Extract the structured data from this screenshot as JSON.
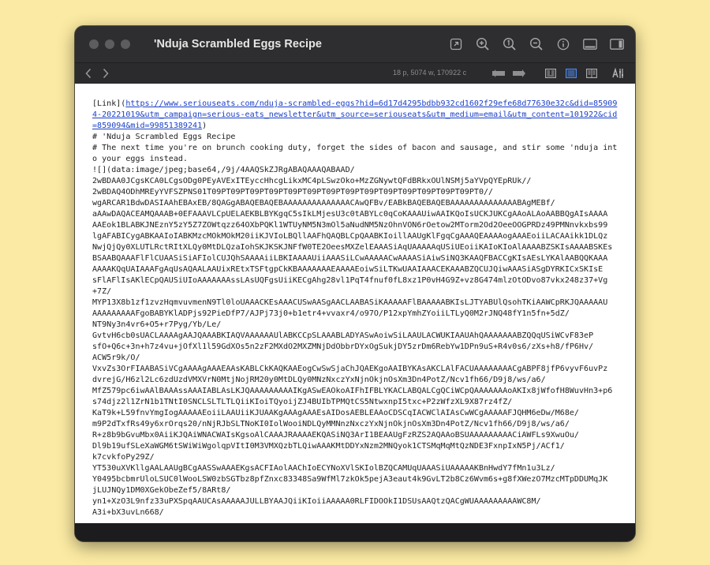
{
  "window": {
    "title": "'Nduja Scrambled Eggs Recipe"
  },
  "titlebar_icons": [
    "share-icon",
    "zoom-in-icon",
    "actual-size-icon",
    "zoom-out-icon",
    "info-icon",
    "sidebar-left-icon",
    "sidebar-right-icon"
  ],
  "toolbar": {
    "stats": "18 p, 5074 w, 170922 c",
    "tools": [
      "fold-icon",
      "unfold-icon",
      "preview-mode-icon",
      "text-mode-icon",
      "split-mode-icon",
      "text-settings-icon"
    ]
  },
  "document": {
    "link_prefix": "[Link](",
    "link_url": "https://www.seriouseats.com/nduja-scrambled-eggs?hid=6d17d4295bdbb932cd1602f29efe68d77630e32c&did=859094-20221019&utm_campaign=serious-eats_newsletter&utm_source=seriouseats&utm_medium=email&utm_content=101922&cid=859094&mid=99851389241",
    "link_suffix": ")",
    "lines": [
      "# 'Nduja Scrambled Eggs Recipe",
      "# The next time you're on brunch cooking duty, forget the sides of bacon and sausage, and stir some 'nduja into your eggs instead.",
      "![](data:image/jpeg;base64,/9j/4AAQSkZJRgABAQAAAQABAAD/",
      "2wBDAA0JCgsKCA0LCgsODg0PEyAVExITEyccHhcgLikxMC4pLSwzOko+MzZGNywtQFdBRkxOUlNSMj5aYVpQYEpRUk//",
      "2wBDAQ4ODhMREyYVFSZPNS01T09PT09PT09PT09PT09PT09PT09PT09PT09PT09PT09PT09PT09PT09PT0//",
      "wgARCAR1BdwDASIAAhEBAxEB/8QAGgABAQEBAQEBAAAAAAAAAAAAAACAwQFBv/EABkBAQEBAQEBAAAAAAAAAAAAAABAgMEBf/",
      "aAAwDAQACEAMQAAAB+0EFAAAVLCpUELAEKBLBYKgqC5sIkLMjesU3c0tABYLc0qCoKAAAUiwAAIKQoIsUCKJUKCgAAoALAoAABBQgAIsAAAA",
      "AAEok1BLABKJNEznY5zY5Z7ZOWtqzz64OXbPQKl1WTUyNM5N3mOl5aNudNM5NzOhnVON6rOetow2MTorm2Od2OeeOOGPRDz49PMNnvkxbs99",
      "lgAFABICygABKAAIoIABKMzcMOkMOkM20iiKJVIoLBQllAAFhQAQBLCpQAABKIoillAAUgKlFgqCgAAAQEAAAAogAAAEoiiLACAAikk1DLQz",
      "NwjQjQy0XLUTLRctRItXLQy0MtDLQzaIohSKJKSKJNFfW0TE2OeesMXZelEAAASiAqUAAAAAqUSiUEoiiKAIoKIoAlAAAABZSKIsAAAABSKEs",
      "BSAABQAAAFlFlCUAASiSiAFIolCUJQhSAAAAiiLBKIAAAAUiiAAASiLCwAAAAACwAAAASiAiwSiNQ3KAAQFBACCgKIsAEsLYKAlAABQQKAAA",
      "AAAAKQqUAIAAAFgAqUsAQAALAAUixREtxTSFtgpCkKBAAAAAAAEAAAAEoiwSiLTKwUAAIAAACEKAAABZQCUJQiwAAASiASgDYRKICxSKIsE",
      "sFlAFlIsAKlECpQAUSiUIoAAAAAAAssLAsUQFgsUiiKECgAhg28vl1PqT4fnuf0fL8xz1P0vH4G9Z+vz8G474mlzOtODvo87vkx248z37+Vg",
      "+7Z/",
      "MYP13X8b1zf1zvzHqmvuvmenN9Tl0loUAAACKEsAAACUSwAASgAACLAABASiKAAAAAFlBAAAAABKIsLJTYABUlQsohTKiAAWCpRKJQAAAAAU",
      "AAAAAAAAAFgoBABYKlADPjs92PieDfP7/AJPj73j0+b1etr4+vvaxr4/o97O/P12xpYmhZYoiiLTLyQ0M2rJNQ48fY1n5fn+5dZ/",
      "NT9Ny3n4vr6+O5+r7Pyg/Yb/Le/",
      "GvtvH6cb0sUACLAAAAgAAJQAAABKIAQVAAAAAAUlABKCCpSLAAABLADYASwAoiwSiLAAULACWUKIAAUAhQAAAAAAABZQQqUSiWCvF83eP",
      "sfO+Q6c+3n+h7z4vu+jOfXl1l59GdXOs5n2zF2MXdO2MXZMNjDdObbrDYxOgSukjDY5zrDm6RebYw1DPn9uS+R4v0s6/zXs+h8/fP6Hv/",
      "ACW5r9k/O/",
      "VxvZs3OrFIAABASiVCgAAAAgAAAEAAsKABLCkKAQKAAEogCwSwSjaChJQAEKgoAAIBYKAsAKCLAlFACUAAAAAAAACgABPF8jfP6vyvF6uvPz",
      "dvrejG/H6zl2Lc6zdUzdVMXVrN0MtjNojRM20y0MtDLQy0MNzNxczYxNjnOkjnOsXm3Dn4PotZ/Ncv1fh66/D9j8/ws/a6/",
      "MfZ579pc6iwAAlBAAAssAAAIABLAsLKJQAAAAAAAAAIKgASwEAOkoAIFhIFBLYKACLABQALCgQCiWCpQAAAAAAAoAKIx8jWfofH8WuvHn3+p6",
      "s74djz2l1ZrN1b1TNtI0SNCLSLTLTLQiiKIoiTQyoijZJ4BUIbTPMQtCS5NtwxnpI5txc+P2zWfzXL9X87rz4fZ/",
      "KaT9k+L59fnvYmgIogAAAAAEoiiLAAUiiKJUAAKgAAAgAAAEsAIDosAEBLEAAoCDSCqIACWClAIAsCwWCgAAAAAFJQHM6eDw/M68e/",
      "m9P2dTxfRs49y6xrOrqs20/nNjRJbSLTNoKI0IolWooiNDLQyMMNnzNxczYxNjnOkjnOsXm3Dn4PotZ/Ncv1fh66/D9j8/ws/a6/",
      "R+z8b9bGvuMbx0AiiKJQAiWNACWAIsKgsoAlCAAAJRAAAAEKQASiNQ3ArI1BEAAUgFzRZS2AQAAoBSUAAAAAAAAACiAWFLs9XwuOu/",
      "Dl9b19ufSLeXaWGM6tSWiWiWgolqpVItI0M3VMXQzbTLQiwAAAKMtDDYxNzm2MNQyok1CTSMqMqMtQzNDE3FxnpIxN5Pj/ACf1/",
      "k7cvkfoPy29Z/",
      "YT530uXVKllgAALAAUgBCgAASSwAAAEKgsACFIAolAAChIoECYNoXVlSKIolBZQCAMUqUAAASiUAAAAAKBnHwdY7fMn1u3Lz/",
      "Y0495bcbmrUloLSUC0lWooLSW0zbSGTbz8pfZnxc83348Sa9WfMl7zkOk5pejA3eaut4k9GvLT2b8Cz6Wvm6s+g8fXWezO7MzcMTpDDUMqJK",
      "jLUJNQy1DM0XGekObeZef5/8ARt8/",
      "yn1+XzO3L9nfz33uPXSpqAAUCAsAAAAAJULLBYAAJQiiKIoiiAAAAA0RLFIDOOkI1DSUsAAQtzQACgWUAAAAAAAAAWC8M/",
      "A3i+bX3uvLn668/"
    ]
  }
}
